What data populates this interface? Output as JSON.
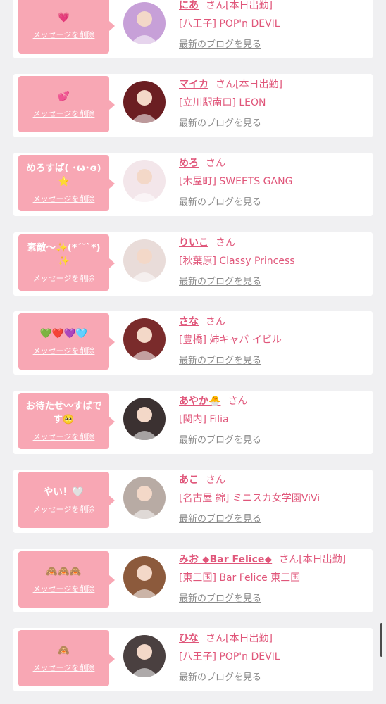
{
  "delete_label": "メッセージを削除",
  "blog_label": "最新のブログを見る",
  "honorific": "さん",
  "colors": {
    "bubble": "#f8a7b4",
    "accent": "#e0567a",
    "link_gray": "#8a8a8a",
    "background": "#f0f0f2"
  },
  "messages": [
    {
      "message": "💗",
      "name": "にあ",
      "status": "[本日出勤]",
      "shop": "[八王子] POP'n DEVIL",
      "avatar_color": "#c7a0d8"
    },
    {
      "message": "💕",
      "name": "マイカ",
      "status": "[本日出勤]",
      "shop": "[立川駅南口] LEON",
      "avatar_color": "#6b1e22"
    },
    {
      "message": "めろすぱ( ･ω･ɞ)⭐️",
      "name": "めろ",
      "status": "",
      "shop": "[木屋町] SWEETS GANG",
      "avatar_color": "#f3e6ea"
    },
    {
      "message": "素敵〜✨(*´˘`*)✨",
      "name": "りいこ",
      "status": "",
      "shop": "[秋葉原] Classy Princess",
      "avatar_color": "#e9dcd9"
    },
    {
      "message": "💚❤️💜🩵",
      "name": "さな",
      "status": "",
      "shop": "[豊橋] 姉キャバ イビル",
      "avatar_color": "#7a2b2b"
    },
    {
      "message": "お待たせ〰︎すぱです🥺",
      "name": "あやか🐣",
      "status": "",
      "shop": "[関内] Filia",
      "avatar_color": "#3b3131"
    },
    {
      "message": "やい！🤍",
      "name": "あこ",
      "status": "",
      "shop": "[名古屋 錦] ミニスカ女学園ViVi",
      "avatar_color": "#b8aba4"
    },
    {
      "message": "🙈🙈🙈",
      "name": "みお ◆Bar Felice◆",
      "status": "[本日出勤]",
      "shop": "[東三国] Bar Felice 東三国",
      "avatar_color": "#8c5a3c"
    },
    {
      "message": "🙈",
      "name": "ひな",
      "status": "[本日出勤]",
      "shop": "[八王子] POP'n DEVIL",
      "avatar_color": "#4a4040"
    }
  ]
}
